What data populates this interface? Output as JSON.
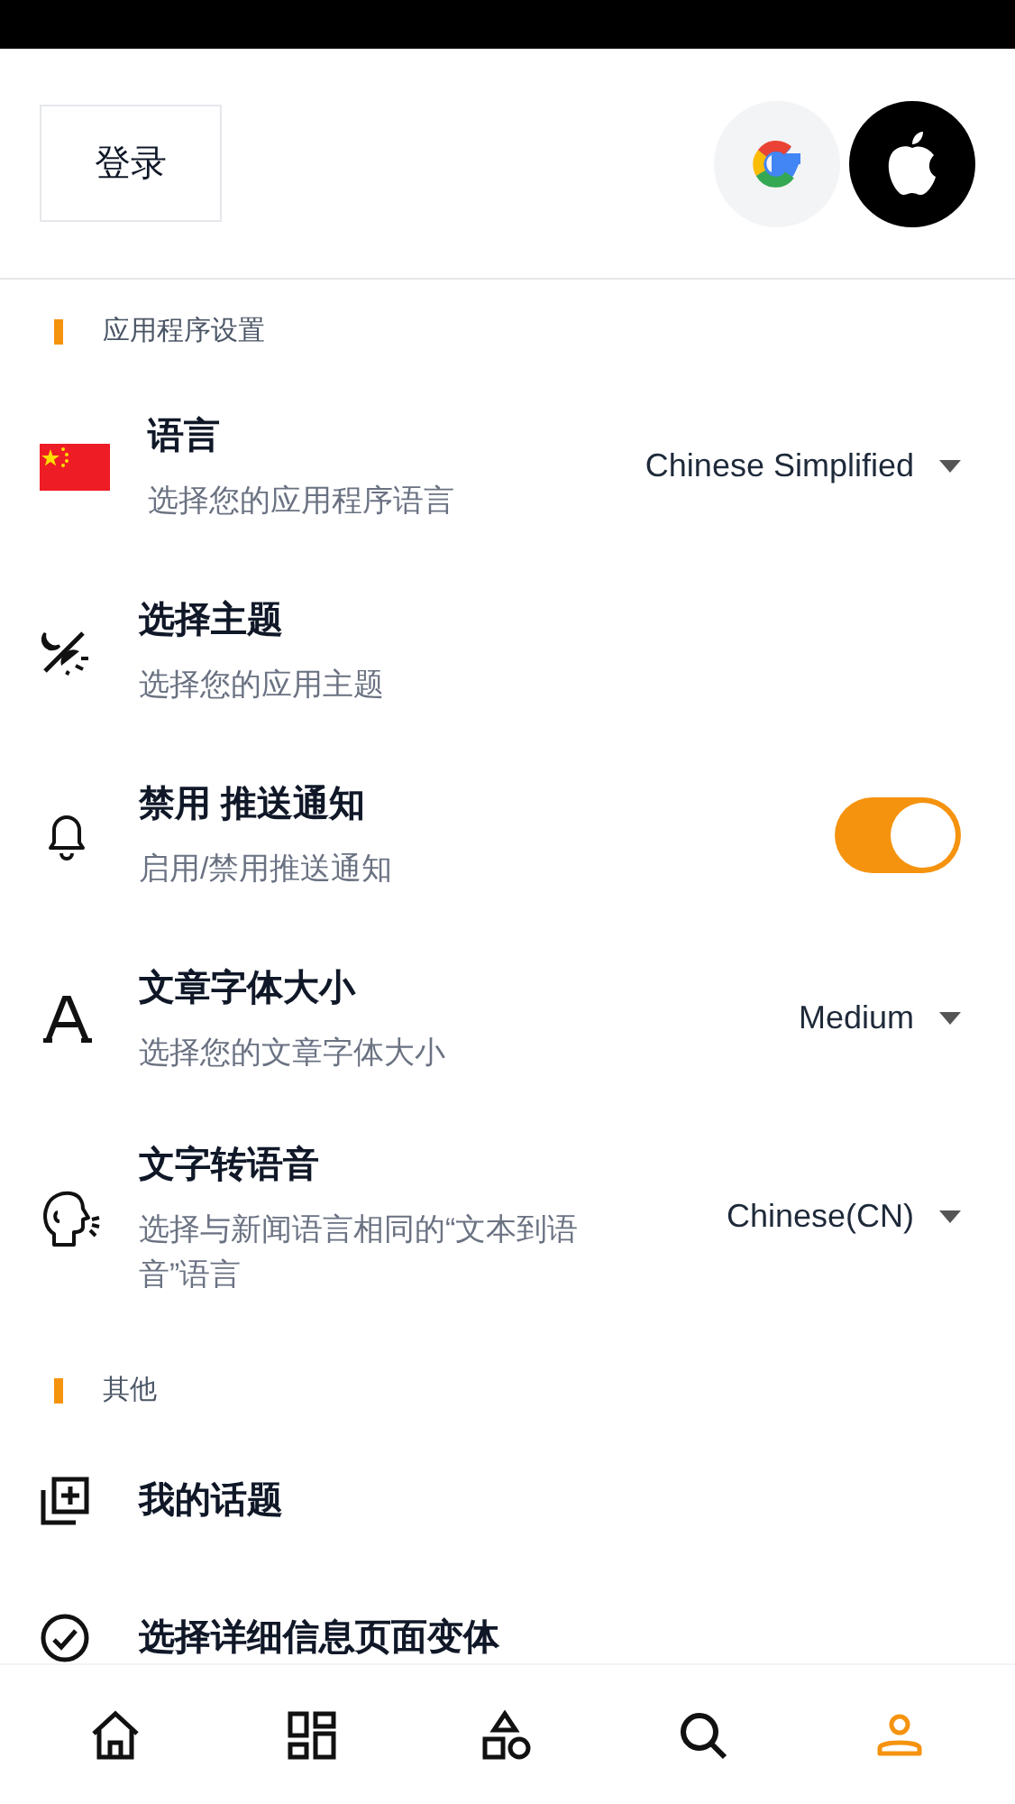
{
  "header": {
    "login_button": "登录"
  },
  "sections": [
    {
      "title": "应用程序设置",
      "items": [
        {
          "kind": "dropdown",
          "title": "语言",
          "subtitle": "选择您的应用程序语言",
          "value": "Chinese Simplified"
        },
        {
          "kind": "plain",
          "title": "选择主题",
          "subtitle": "选择您的应用主题"
        },
        {
          "kind": "toggle",
          "title": "禁用 推送通知",
          "subtitle": "启用/禁用推送通知",
          "on": true
        },
        {
          "kind": "dropdown",
          "title": "文章字体大小",
          "subtitle": "选择您的文章字体大小",
          "value": "Medium"
        },
        {
          "kind": "dropdown",
          "title": "文字转语音",
          "subtitle": "选择与新闻语言相同的“文本到语音”语言",
          "value": "Chinese(CN)"
        }
      ]
    },
    {
      "title": "其他",
      "items": [
        {
          "kind": "plain",
          "title": "我的话题"
        },
        {
          "kind": "plain",
          "title": "选择详细信息页面变体"
        }
      ]
    }
  ],
  "nav": [
    {
      "selected": false
    },
    {
      "selected": false
    },
    {
      "selected": false
    },
    {
      "selected": false
    },
    {
      "selected": true
    }
  ]
}
